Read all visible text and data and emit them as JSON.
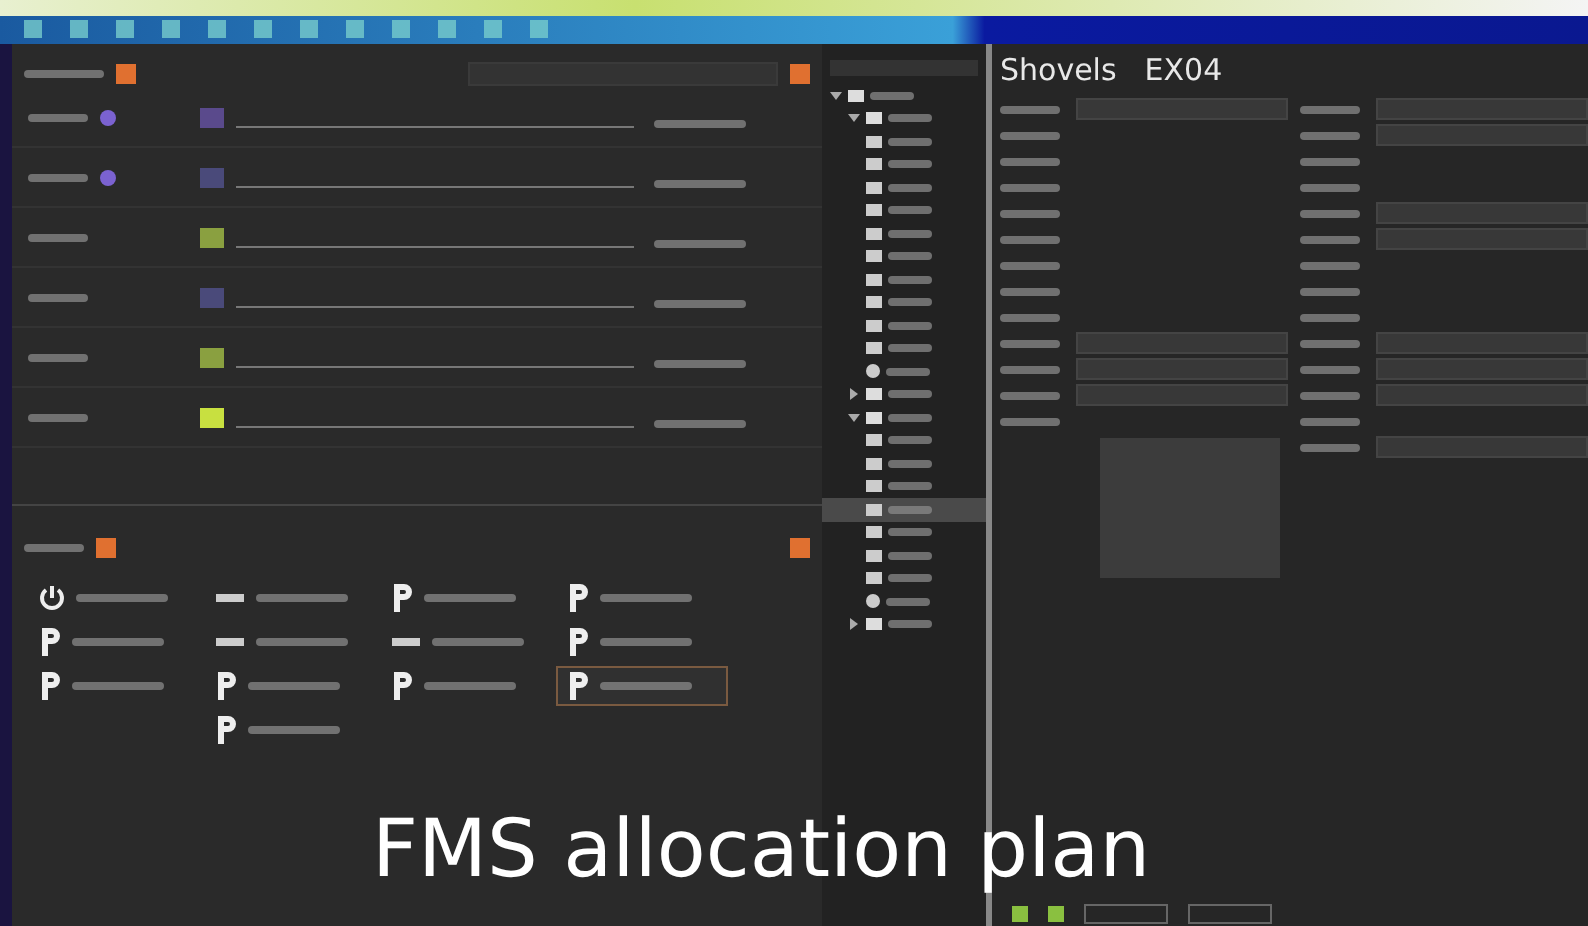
{
  "shovel_panel": {
    "rows": [
      {
        "color": "#5a4a8c",
        "has_badge": true
      },
      {
        "color": "#4a4a7a",
        "has_badge": true
      },
      {
        "color": "#8aa040",
        "has_badge": false
      },
      {
        "color": "#4a4a7a",
        "has_badge": false
      },
      {
        "color": "#8aa040",
        "has_badge": false
      },
      {
        "color": "#c8e040",
        "has_badge": false
      }
    ]
  },
  "task_panel": {
    "tiles": [
      {
        "kind": "power",
        "selected": false
      },
      {
        "kind": "machine",
        "selected": false
      },
      {
        "kind": "parking",
        "selected": false
      },
      {
        "kind": "parking",
        "selected": false
      },
      {
        "kind": "parking",
        "selected": false
      },
      {
        "kind": "machine",
        "selected": false
      },
      {
        "kind": "machine",
        "selected": false
      },
      {
        "kind": "parking",
        "selected": false
      },
      {
        "kind": "parking",
        "selected": false
      },
      {
        "kind": "parking",
        "selected": false
      },
      {
        "kind": "parking",
        "selected": false
      },
      {
        "kind": "parking",
        "selected": true
      },
      {
        "kind": "empty"
      },
      {
        "kind": "parking",
        "selected": false
      }
    ]
  },
  "tree": {
    "items": [
      {
        "kind": "folder",
        "expanded": true,
        "selected": false,
        "children": [
          {
            "kind": "folder",
            "expanded": true,
            "selected": false,
            "children": [
              {
                "kind": "truck",
                "selected": false
              },
              {
                "kind": "truck",
                "selected": false
              },
              {
                "kind": "truck",
                "selected": false
              },
              {
                "kind": "truck",
                "selected": false
              },
              {
                "kind": "truck",
                "selected": false
              },
              {
                "kind": "truck",
                "selected": false
              },
              {
                "kind": "truck",
                "selected": false
              },
              {
                "kind": "truck",
                "selected": false
              },
              {
                "kind": "truck",
                "selected": false
              },
              {
                "kind": "truck",
                "selected": false
              },
              {
                "kind": "round",
                "selected": false
              }
            ]
          },
          {
            "kind": "folder",
            "expanded": false,
            "selected": false
          },
          {
            "kind": "folder",
            "expanded": true,
            "selected": false,
            "children": [
              {
                "kind": "shovel",
                "selected": false
              },
              {
                "kind": "shovel",
                "selected": false
              },
              {
                "kind": "shovel",
                "selected": false
              },
              {
                "kind": "shovel",
                "selected": true
              },
              {
                "kind": "shovel",
                "selected": false
              },
              {
                "kind": "shovel",
                "selected": false
              },
              {
                "kind": "shovel",
                "selected": false
              },
              {
                "kind": "round",
                "selected": false
              }
            ]
          },
          {
            "kind": "folder",
            "expanded": false,
            "selected": false
          }
        ]
      }
    ]
  },
  "detail": {
    "title": "Shovels",
    "subtitle": "EX04"
  },
  "status_bar": {
    "checks": [
      {
        "checked": true
      },
      {
        "checked": true
      }
    ]
  },
  "caption": "FMS allocation plan"
}
